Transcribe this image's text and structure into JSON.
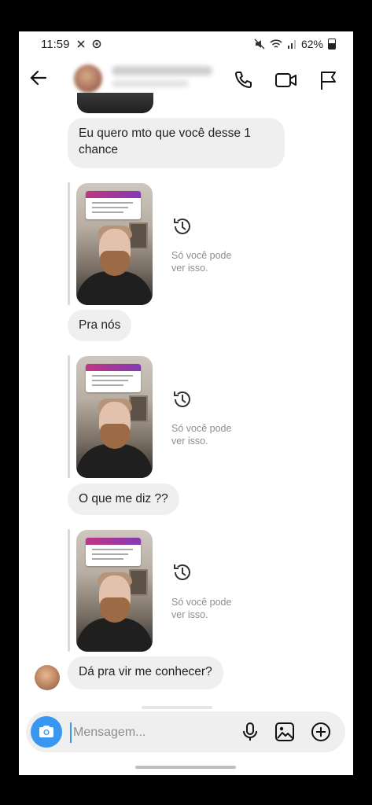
{
  "status_bar": {
    "time": "11:59",
    "battery": "62%",
    "battery_level": 0.62
  },
  "header": {
    "contact_name": "Ambrosio Beth",
    "contact_status": "Online há 10 min"
  },
  "messages": [
    {
      "type": "text",
      "text": "Eu quero mto que você desse 1 chance"
    },
    {
      "type": "story_reply",
      "note": "Só você pode ver isso."
    },
    {
      "type": "text",
      "text": "Pra nós"
    },
    {
      "type": "story_reply",
      "note": "Só você pode ver isso."
    },
    {
      "type": "text",
      "text": "O que  me diz ??"
    },
    {
      "type": "story_reply",
      "note": "Só você pode ver isso."
    },
    {
      "type": "text",
      "text": "Dá  pra vir me conhecer?"
    }
  ],
  "composer": {
    "placeholder": "Mensagem..."
  },
  "colors": {
    "accent": "#3897f0",
    "bubble": "#efefef",
    "muted_text": "#8e8e8e"
  },
  "icons": [
    "back-arrow-icon",
    "phone-icon",
    "video-call-icon",
    "flag-icon",
    "history-icon",
    "camera-icon",
    "microphone-icon",
    "gallery-icon",
    "add-icon"
  ]
}
